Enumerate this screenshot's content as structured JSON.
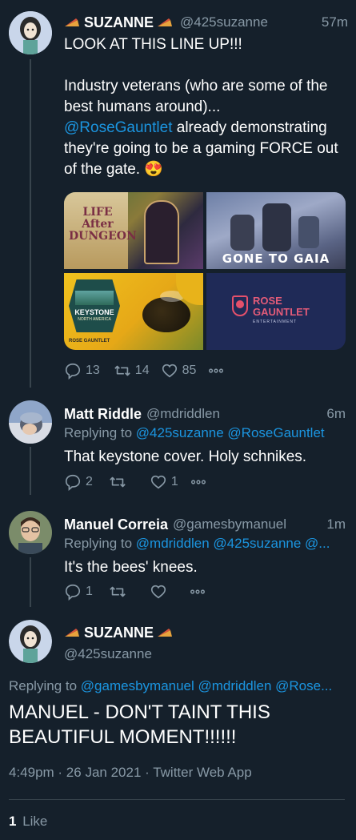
{
  "tweets": [
    {
      "name": "SUZANNE",
      "handle": "@425suzanne",
      "time": "57m",
      "text_line1": "LOOK AT THIS LINE UP!!!",
      "text_para2_a": "Industry veterans (who are some of the best humans around)...",
      "text_mention": "@RoseGauntlet",
      "text_para2_b": " already demonstrating they're going to be a gaming FORCE out of the gate. 😍",
      "media": {
        "tile1_text": "LIFE After DUNGEON",
        "tile2_text": "GONE TO GAIA",
        "tile3_text": "KEYSTONE",
        "tile3_sub": "NORTH AMERICA",
        "tile3_brand": "ROSE GAUNTLET",
        "tile4_line1": "ROSE",
        "tile4_line2": "GAUNTLET",
        "tile4_line3": "ENTERTAINMENT"
      },
      "replies": "13",
      "retweets": "14",
      "likes": "85"
    },
    {
      "name": "Matt Riddle",
      "handle": "@mdriddlen",
      "time": "6m",
      "replying_label": "Replying to",
      "replying_to": "@425suzanne @RoseGauntlet",
      "text": "That keystone cover. Holy schnikes.",
      "replies": "2",
      "retweets": "",
      "likes": "1"
    },
    {
      "name": "Manuel Correia",
      "handle": "@gamesbymanuel",
      "time": "1m",
      "replying_label": "Replying to",
      "replying_to": "@mdriddlen @425suzanne @...",
      "text": "It's the bees' knees.",
      "replies": "1",
      "retweets": "",
      "likes": ""
    }
  ],
  "focus": {
    "name": "SUZANNE",
    "handle": "@425suzanne",
    "replying_label": "Replying to",
    "replying_to": "@gamesbymanuel @mdriddlen @Rose...",
    "text": "MANUEL - DON'T TAINT THIS BEAUTIFUL MOMENT!!!!!!",
    "meta": "4:49pm · 26 Jan 2021 · Twitter Web App",
    "like_count": "1",
    "like_label": "Like"
  },
  "colors": {
    "background": "#15202b",
    "link": "#1b95e0",
    "muted": "#8899a6",
    "divider": "#38444d"
  }
}
